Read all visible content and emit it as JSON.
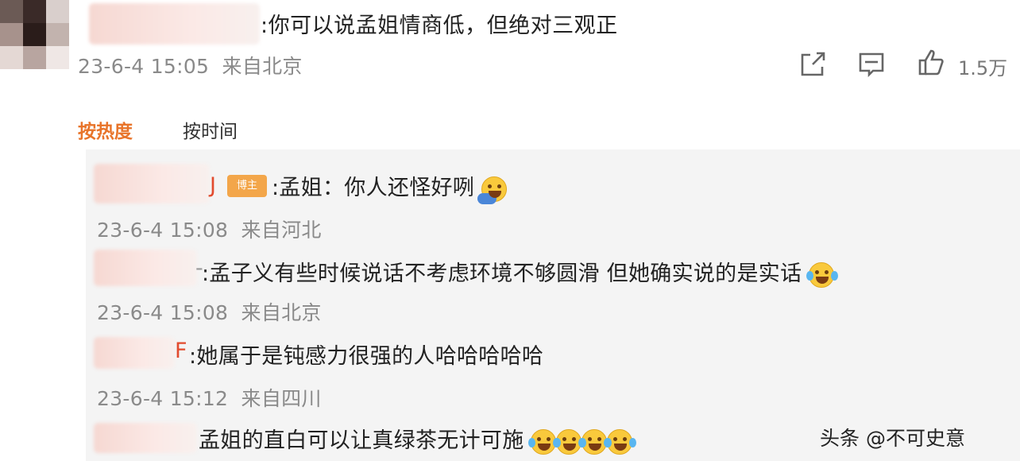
{
  "top_comment": {
    "text": ":你可以说孟姐情商低，但绝对三观正",
    "time": "23-6-4 15:05",
    "location": "来自北京",
    "like_count": "1.5万",
    "icons": [
      "share-icon",
      "comment-icon",
      "like-icon"
    ]
  },
  "sort_tabs": {
    "hot": "按热度",
    "time": "按时间"
  },
  "replies": [
    {
      "name_tail": "J",
      "badge": "博主",
      "text": ":孟姐：你人还怪好咧",
      "emoji": [
        "face-palm-emoji"
      ],
      "time": "23-6-4 15:08",
      "location": "来自河北"
    },
    {
      "name_tail": "-",
      "text": ":孟子义有些时候说话不考虑环境不够圆滑 但她确实说的是实话",
      "emoji": [
        "laugh-cry-emoji"
      ],
      "time": "23-6-4 15:08",
      "location": "来自北京"
    },
    {
      "name_tail": "F",
      "text": ":她属于是钝感力很强的人哈哈哈哈哈",
      "emoji": [],
      "time": "23-6-4 15:12",
      "location": "来自四川"
    },
    {
      "name_tail": "",
      "text": "孟姐的直白可以让真绿茶无计可施",
      "emoji": [
        "laugh-cry-emoji",
        "laugh-cry-emoji",
        "laugh-cry-emoji",
        "laugh-cry-emoji"
      ],
      "time": "",
      "location": ""
    }
  ],
  "watermark": "头条 @不可史意",
  "colors": {
    "accent_hot_tab": "#e8742a",
    "name_red": "#e24b2e",
    "badge_orange": "#f3a64a",
    "meta_gray": "#8a8a8a",
    "panel_bg": "#f4f4f4"
  }
}
